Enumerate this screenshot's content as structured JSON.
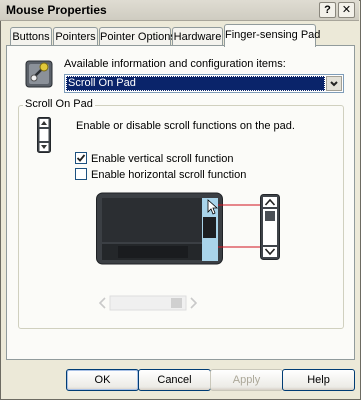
{
  "window": {
    "title": "Mouse Properties",
    "help_glyph": "?",
    "close_glyph": "✕"
  },
  "tabs": [
    {
      "label": "Buttons",
      "active": false
    },
    {
      "label": "Pointers",
      "active": false
    },
    {
      "label": "Pointer Options",
      "active": false
    },
    {
      "label": "Hardware",
      "active": false
    },
    {
      "label": "Finger-sensing Pad",
      "active": true
    }
  ],
  "page": {
    "items_label": "Available information and configuration items:",
    "items_selected": "Scroll On Pad",
    "group_title": "Scroll On Pad",
    "description": "Enable or disable scroll functions on the pad.",
    "options": [
      {
        "label": "Enable vertical scroll function",
        "checked": true
      },
      {
        "label": "Enable horizontal scroll function",
        "checked": false
      }
    ]
  },
  "buttons": {
    "ok": "OK",
    "cancel": "Cancel",
    "apply": "Apply",
    "help": "Help"
  },
  "colors": {
    "selection": "#0a246a",
    "scroll_zone": "#a9d4ea",
    "pointer_line": "#d0101e"
  }
}
